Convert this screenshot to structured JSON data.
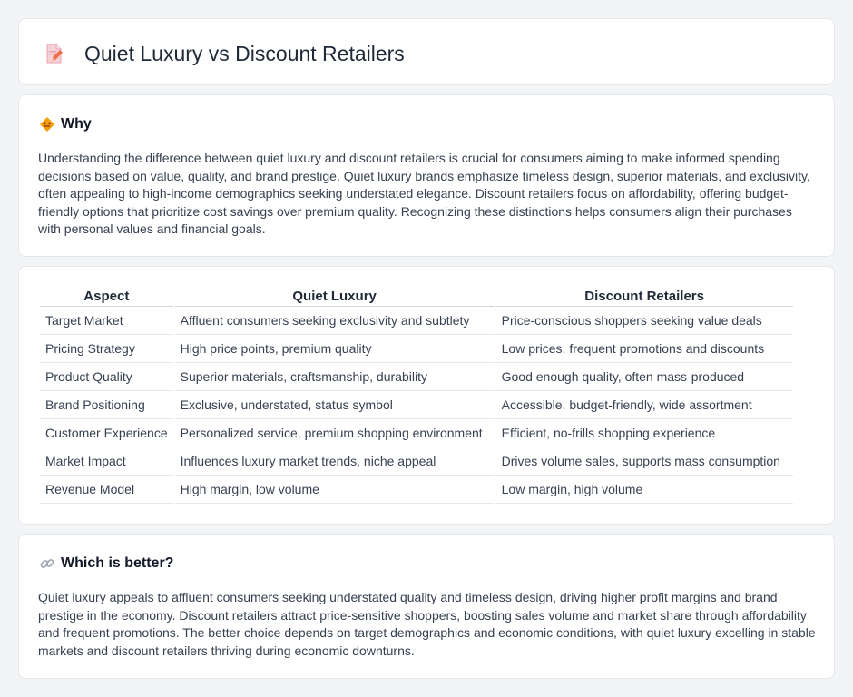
{
  "page": {
    "title": "Quiet Luxury vs Discount Retailers"
  },
  "why": {
    "heading": "Why",
    "icon": "diamond-warning-icon",
    "text": "Understanding the difference between quiet luxury and discount retailers is crucial for consumers aiming to make informed spending decisions based on value, quality, and brand prestige. Quiet luxury brands emphasize timeless design, superior materials, and exclusivity, often appealing to high-income demographics seeking understated elegance. Discount retailers focus on affordability, offering budget-friendly options that prioritize cost savings over premium quality. Recognizing these distinctions helps consumers align their purchases with personal values and financial goals."
  },
  "table": {
    "headers": [
      "Aspect",
      "Quiet Luxury",
      "Discount Retailers"
    ],
    "rows": [
      [
        "Target Market",
        "Affluent consumers seeking exclusivity and subtlety",
        "Price-conscious shoppers seeking value deals"
      ],
      [
        "Pricing Strategy",
        "High price points, premium quality",
        "Low prices, frequent promotions and discounts"
      ],
      [
        "Product Quality",
        "Superior materials, craftsmanship, durability",
        "Good enough quality, often mass-produced"
      ],
      [
        "Brand Positioning",
        "Exclusive, understated, status symbol",
        "Accessible, budget-friendly, wide assortment"
      ],
      [
        "Customer Experience",
        "Personalized service, premium shopping environment",
        "Efficient, no-frills shopping experience"
      ],
      [
        "Market Impact",
        "Influences luxury market trends, niche appeal",
        "Drives volume sales, supports mass consumption"
      ],
      [
        "Revenue Model",
        "High margin, low volume",
        "Low margin, high volume"
      ]
    ]
  },
  "better": {
    "heading": "Which is better?",
    "icon": "link-icon",
    "text": "Quiet luxury appeals to affluent consumers seeking understated quality and timeless design, driving higher profit margins and brand prestige in the economy. Discount retailers attract price-sensitive shoppers, boosting sales volume and market share through affordability and frequent promotions. The better choice depends on target demographics and economic conditions, with quiet luxury excelling in stable markets and discount retailers thriving during economic downturns."
  },
  "colors": {
    "background": "#f3f4f6",
    "card": "#ffffff",
    "accent_orange": "#f59e0b",
    "document_icon": "#fb7185"
  }
}
